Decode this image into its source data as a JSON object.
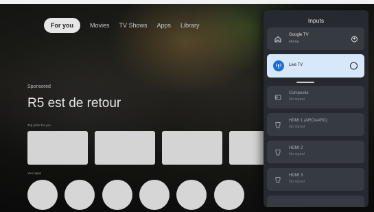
{
  "home": {
    "tabs": [
      "For you",
      "Movies",
      "TV Shows",
      "Apps",
      "Library"
    ],
    "sponsored_label": "Sponsored",
    "hero_title": "R5 est de retour",
    "row1_label": "Top picks for you",
    "row2_label": "Your apps"
  },
  "inputs_panel": {
    "title": "Inputs",
    "items": [
      {
        "name": "Google TV",
        "sub": "Home",
        "icon": "home-icon",
        "selected": true
      },
      {
        "name": "Live TV",
        "sub": "",
        "icon": "antenna-icon",
        "selected": false,
        "focused": true
      },
      {
        "name": "Composite",
        "sub": "No signal",
        "icon": "input-icon"
      },
      {
        "name": "HDMI 1 (ARC/eARC)",
        "sub": "No signal",
        "icon": "hdmi-icon"
      },
      {
        "name": "HDMI 2",
        "sub": "No signal",
        "icon": "hdmi-icon"
      },
      {
        "name": "HDMI 3",
        "sub": "No signal",
        "icon": "hdmi-icon"
      }
    ]
  },
  "colors": {
    "focus_bg": "#d6e8f9",
    "focus_icon": "#1f6dd0",
    "panel_bg": "#26292f"
  }
}
